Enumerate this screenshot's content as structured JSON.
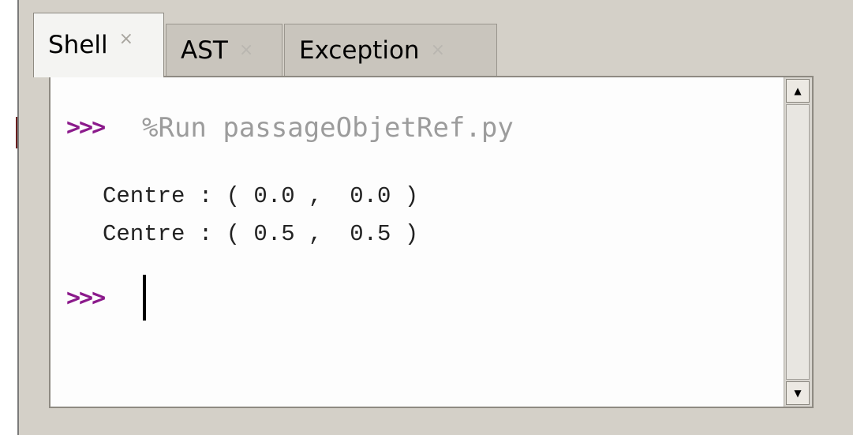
{
  "tabs": [
    {
      "label": "Shell",
      "close": "×",
      "active": true
    },
    {
      "label": "AST",
      "close": "×",
      "active": false
    },
    {
      "label": "Exception",
      "close": "×",
      "active": false
    }
  ],
  "shell": {
    "prompt": ">>>",
    "command": "%Run passageObjetRef.py",
    "output": [
      "Centre : ( 0.0 ,  0.0 )",
      "Centre : ( 0.5 ,  0.5 )"
    ],
    "prompt_second": ">>>"
  },
  "scrollbar": {
    "up_arrow": "▲",
    "down_arrow": "▼"
  },
  "colors": {
    "prompt": "#8b1a8b",
    "command": "#9c9c9c",
    "output": "#222222"
  }
}
